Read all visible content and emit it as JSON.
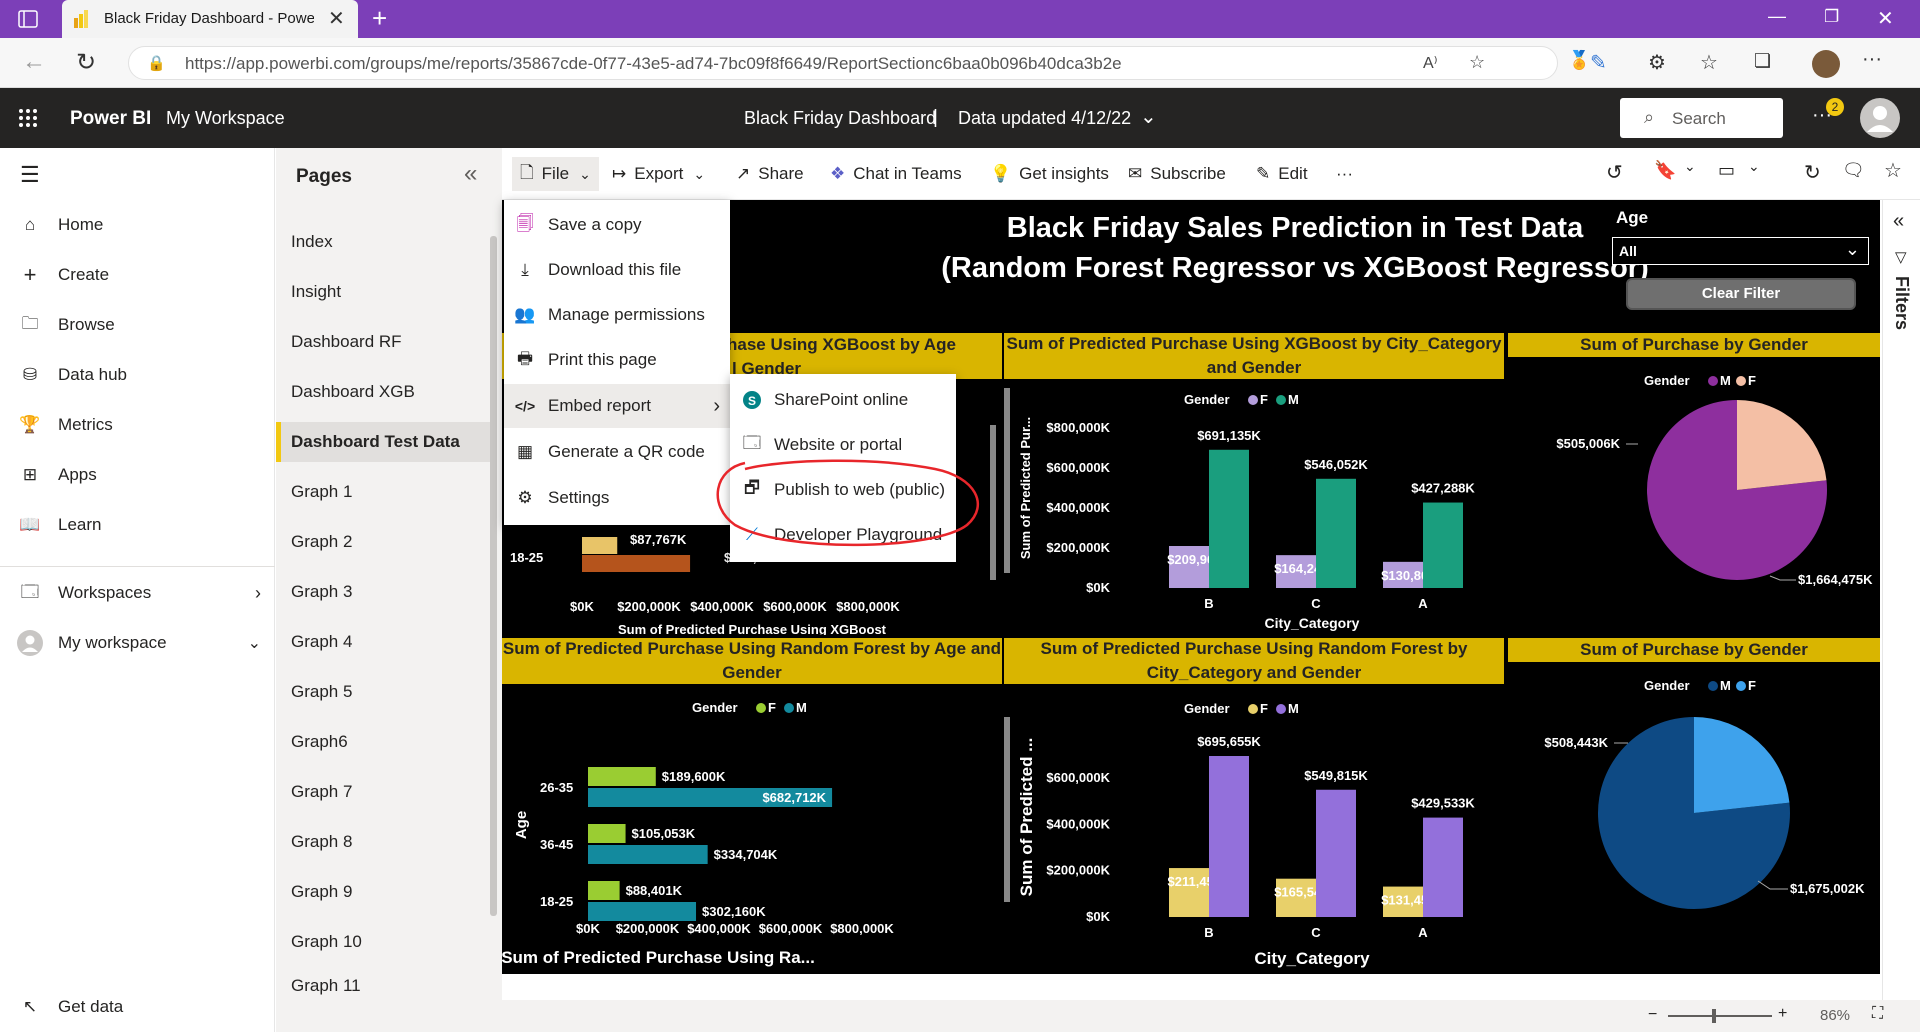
{
  "browser": {
    "tab_title": "Black Friday Dashboard - Power",
    "url": "https://app.powerbi.com/groups/me/reports/35867cde-0f77-43e5-ad74-7bc09f8f6649/ReportSectionc6baa0b096b40dca3b2e"
  },
  "header": {
    "app_name": "Power BI",
    "workspace": "My Workspace",
    "report_title": "Black Friday Dashboard",
    "separator": "|",
    "data_updated": "Data updated 4/12/22",
    "search_placeholder": "Search",
    "notification_count": "2"
  },
  "leftnav": {
    "items": [
      "Home",
      "Create",
      "Browse",
      "Data hub",
      "Metrics",
      "Apps",
      "Learn"
    ],
    "workspaces": "Workspaces",
    "my_workspace": "My workspace",
    "get_data": "Get data"
  },
  "pages": {
    "title": "Pages",
    "items": [
      "Index",
      "Insight",
      "Dashboard RF",
      "Dashboard XGB",
      "Dashboard Test Data",
      "Graph 1",
      "Graph 2",
      "Graph 3",
      "Graph 4",
      "Graph 5",
      "Graph6",
      "Graph 7",
      "Graph 8",
      "Graph 9",
      "Graph 10",
      "Graph 11"
    ],
    "active": "Dashboard Test Data"
  },
  "toolbar": {
    "file": "File",
    "export": "Export",
    "share": "Share",
    "chat": "Chat in Teams",
    "insights": "Get insights",
    "subscribe": "Subscribe",
    "edit": "Edit",
    "more": "···"
  },
  "file_menu": {
    "items": [
      "Save a copy",
      "Download this file",
      "Manage permissions",
      "Print this page",
      "Embed report",
      "Generate a QR code",
      "Settings"
    ]
  },
  "embed_submenu": {
    "items": [
      "SharePoint online",
      "Website or portal",
      "Publish to web (public)",
      "Developer Playground"
    ]
  },
  "report": {
    "title_line1": "Black Friday Sales Prediction in Test Data",
    "title_line2": "(Random Forest Regressor vs XGBoost Regressor)",
    "slicer_label": "Age",
    "slicer_value": "All",
    "clear_filter": "Clear Filter",
    "filters_label": "Filters"
  },
  "chart_data": [
    {
      "type": "bar",
      "orientation": "horizontal",
      "title": "Sum of Predicted Purchase Using XGBoost by Age and Gender",
      "title_visible": [
        "hase Using XGBoost by Age",
        "l Gender"
      ],
      "categories": [
        "18-25"
      ],
      "series": [
        {
          "name": "F",
          "values": [
            87767
          ]
        },
        {
          "name": "M",
          "values": [
            null
          ]
        }
      ],
      "data_labels": [
        "$87,767K",
        "$305,242K"
      ],
      "xlabel": "Sum of Predicted Purchase Using XGBoost",
      "x_ticks": [
        "$0K",
        "$200,000K",
        "$400,000K",
        "$600,000K",
        "$800,000K"
      ],
      "colors": {
        "F": "#e8c468",
        "M": "#b5541c"
      }
    },
    {
      "type": "bar",
      "title": "Sum of Predicted Purchase Using XGBoost by City_Category and Gender",
      "legend_title": "Gender",
      "legend": [
        "F",
        "M"
      ],
      "categories": [
        "B",
        "C",
        "A"
      ],
      "series": [
        {
          "name": "F",
          "values": [
            209962,
            164240,
            130805
          ],
          "color": "#b39ddb"
        },
        {
          "name": "M",
          "values": [
            691135,
            546052,
            427288
          ],
          "color": "#1a9e7e"
        }
      ],
      "data_labels": {
        "F": [
          "$209,962K",
          "$164,240K",
          "$130,805K"
        ],
        "M": [
          "$691,135K",
          "$546,052K",
          "$427,288K"
        ]
      },
      "xlabel": "City_Category",
      "ylabel": "Sum of Predicted Pur...",
      "y_ticks": [
        "$0K",
        "$200,000K",
        "$400,000K",
        "$600,000K",
        "$800,000K"
      ],
      "ylim": [
        0,
        800000
      ]
    },
    {
      "type": "pie",
      "title": "Sum of Purchase by Gender",
      "legend_title": "Gender",
      "legend": [
        "M",
        "F"
      ],
      "slices": [
        {
          "name": "M",
          "value": 1664475,
          "label": "$1,664,475K",
          "color": "#8e2f9e"
        },
        {
          "name": "F",
          "value": 505006,
          "label": "$505,006K",
          "color": "#f4bfa5"
        }
      ]
    },
    {
      "type": "bar",
      "orientation": "horizontal",
      "title": "Sum of Predicted Purchase Using Random Forest by Age and Gender",
      "legend_title": "Gender",
      "legend": [
        "F",
        "M"
      ],
      "categories": [
        "26-35",
        "36-45",
        "18-25"
      ],
      "series": [
        {
          "name": "F",
          "values": [
            189600,
            105053,
            88401
          ],
          "color": "#9acd32"
        },
        {
          "name": "M",
          "values": [
            682712,
            334704,
            302160
          ],
          "color": "#138a9e"
        }
      ],
      "data_labels": {
        "F": [
          "$189,600K",
          "$105,053K",
          "$88,401K"
        ],
        "M": [
          "$682,712K",
          "$334,704K",
          "$302,160K"
        ]
      },
      "xlabel": "Sum of Predicted Purchase Using Ra...",
      "ylabel": "Age",
      "x_ticks": [
        "$0K",
        "$200,000K",
        "$400,000K",
        "$600,000K",
        "$800,000K"
      ],
      "xlim": [
        0,
        800000
      ]
    },
    {
      "type": "bar",
      "title": "Sum of Predicted Purchase Using Random Forest by City_Category and Gender",
      "legend_title": "Gender",
      "legend": [
        "F",
        "M"
      ],
      "categories": [
        "B",
        "C",
        "A"
      ],
      "series": [
        {
          "name": "F",
          "values": [
            211451,
            165542,
            131450
          ],
          "color": "#e8d06a"
        },
        {
          "name": "M",
          "values": [
            695655,
            549815,
            429533
          ],
          "color": "#9370db"
        }
      ],
      "data_labels": {
        "F": [
          "$211,451K",
          "$165,542K",
          "$131,450K"
        ],
        "M": [
          "$695,655K",
          "$549,815K",
          "$429,533K"
        ]
      },
      "xlabel": "City_Category",
      "ylabel": "Sum of Predicted ...",
      "y_ticks": [
        "$0K",
        "$200,000K",
        "$400,000K",
        "$600,000K"
      ],
      "ylim": [
        0,
        700000
      ]
    },
    {
      "type": "pie",
      "title": "Sum of Purchase by Gender",
      "legend_title": "Gender",
      "legend": [
        "M",
        "F"
      ],
      "slices": [
        {
          "name": "M",
          "value": 1675002,
          "label": "$1,675,002K",
          "color": "#0e4a84"
        },
        {
          "name": "F",
          "value": 508443,
          "label": "$508,443K",
          "color": "#3ea2ec"
        }
      ]
    }
  ],
  "status": {
    "zoom": "86%"
  }
}
